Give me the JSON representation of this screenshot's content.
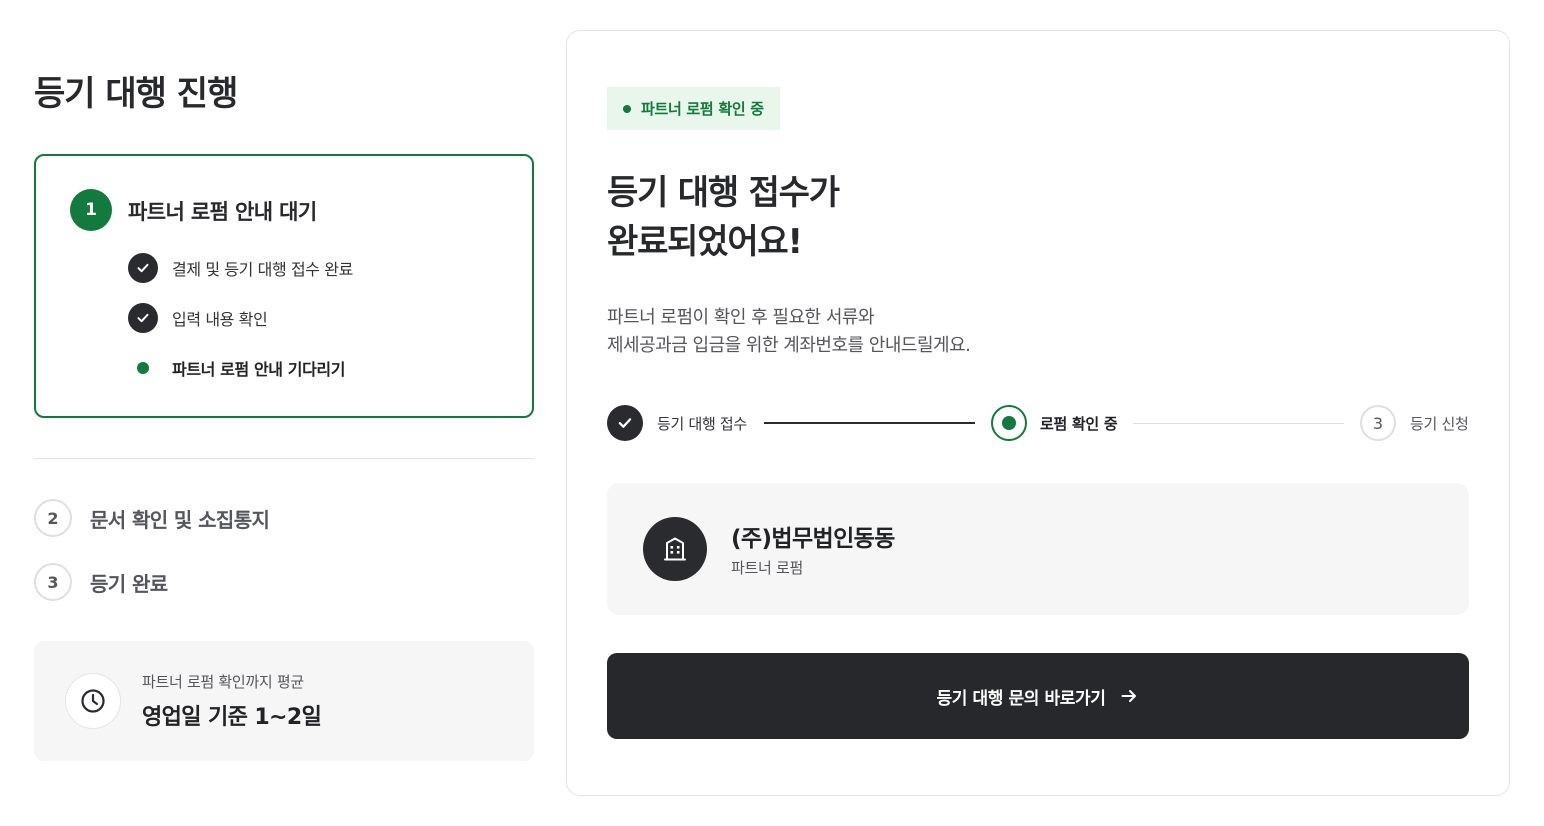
{
  "page_title": "등기 대행 진행",
  "steps_panel": {
    "active_step": {
      "number": "1",
      "title": "파트너 로펌 안내 대기",
      "sub_items": [
        {
          "label": "결제 및 등기 대행 접수 완료",
          "state": "done"
        },
        {
          "label": "입력 내용 확인",
          "state": "done"
        },
        {
          "label": "파트너 로펌 안내 기다리기",
          "state": "current"
        }
      ]
    },
    "other_steps": [
      {
        "number": "2",
        "title": "문서 확인 및 소집통지"
      },
      {
        "number": "3",
        "title": "등기 완료"
      }
    ],
    "average": {
      "label": "파트너 로펌 확인까지 평균",
      "value": "영업일 기준 1~2일",
      "icon": "clock-icon"
    }
  },
  "main": {
    "status_badge": "파트너 로펌 확인 중",
    "headline_line1": "등기 대행 접수가",
    "headline_line2": "완료되었어요!",
    "desc_line1": "파트너 로펌이 확인 후 필요한 서류와",
    "desc_line2": "제세공과금 입금을 위한 계좌번호를 안내드릴게요.",
    "progress": [
      {
        "label": "등기 대행 접수",
        "state": "done"
      },
      {
        "label": "로펌 확인 중",
        "state": "current"
      },
      {
        "number": "3",
        "label": "등기 신청",
        "state": "pending"
      }
    ],
    "partner": {
      "name": "(주)법무법인동동",
      "role": "파트너 로펌",
      "icon": "building-icon"
    },
    "cta_label": "등기 대행 문의 바로가기"
  },
  "colors": {
    "accent": "#117a3c",
    "badge_bg": "#e8f6ec",
    "dark": "#27282c",
    "muted": "#55565c",
    "card_bg": "#f6f6f7"
  }
}
